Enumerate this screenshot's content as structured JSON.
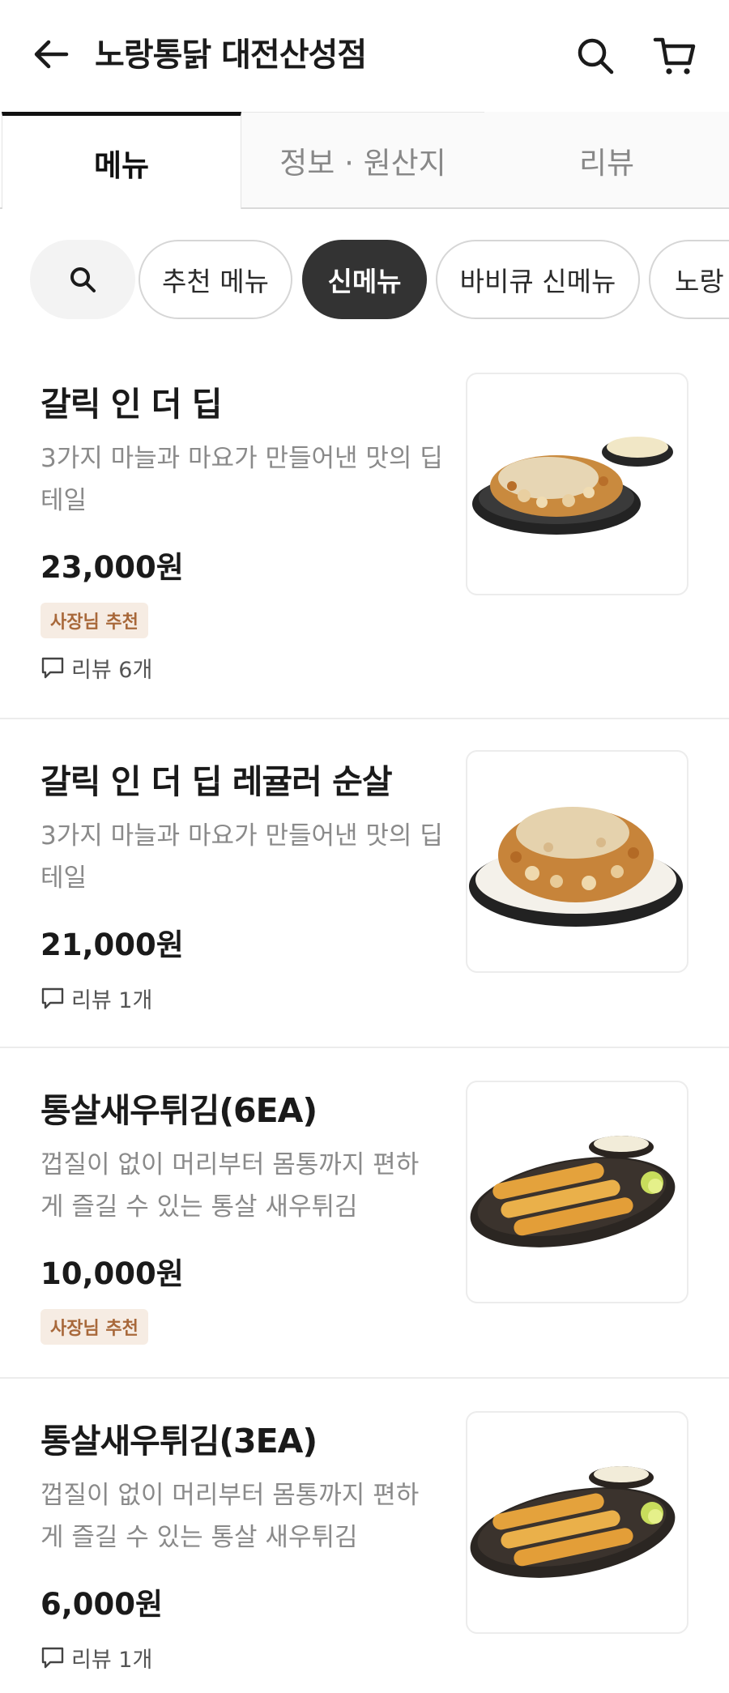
{
  "header": {
    "title": "노랑통닭 대전산성점",
    "back_icon": "arrow-left-icon",
    "search_icon": "search-icon",
    "cart_icon": "cart-icon"
  },
  "tabs": [
    {
      "label": "메뉴",
      "active": true
    },
    {
      "label": "정보 · 원산지",
      "active": false
    },
    {
      "label": "리뷰",
      "active": false
    }
  ],
  "categories": {
    "search_icon": "search-icon",
    "items": [
      {
        "label": "추천 메뉴",
        "active": false
      },
      {
        "label": "신메뉴",
        "active": true
      },
      {
        "label": "바비큐 신메뉴",
        "active": false
      },
      {
        "label": "노랑",
        "active": false
      }
    ]
  },
  "menu_items": [
    {
      "name": "갈릭 인 더 딥",
      "description": "3가지 마늘과 마요가 만들어낸 맛의 딥테일",
      "price": "23,000원",
      "badge": "사장님 추천",
      "review": "리뷰 6개",
      "image": "garlic-chicken-plate-with-sauce"
    },
    {
      "name": "갈릭 인 더 딥 레귤러 순살",
      "description": "3가지 마늘과 마요가 만들어낸 맛의 딥테일",
      "price": "21,000원",
      "badge": "",
      "review": "리뷰 1개",
      "image": "garlic-boneless-chicken-plate"
    },
    {
      "name": "통살새우튀김(6EA)",
      "description": "껍질이 없이 머리부터 몸통까지 편하게 즐길 수 있는 통살 새우튀김",
      "price": "10,000원",
      "badge": "사장님 추천",
      "review": "",
      "image": "fried-shrimp-plate"
    },
    {
      "name": "통살새우튀김(3EA)",
      "description": "껍질이 없이 머리부터 몸통까지 편하게 즐길 수 있는 통살 새우튀김",
      "price": "6,000원",
      "badge": "",
      "review": "리뷰 1개",
      "image": "fried-shrimp-plate"
    }
  ],
  "colors": {
    "active_chip": "#333333",
    "badge_bg": "#f6ece3",
    "badge_text": "#a8683a",
    "muted_text": "#8a8a8a"
  }
}
